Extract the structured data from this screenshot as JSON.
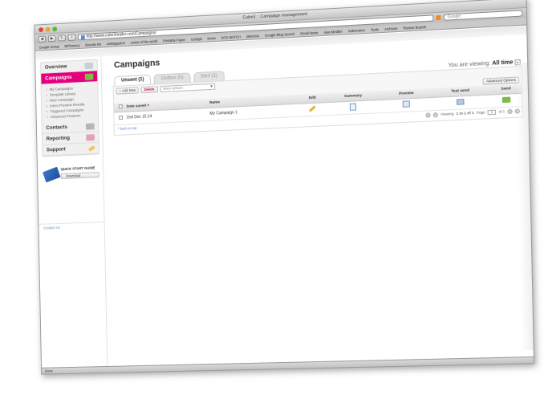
{
  "window": {
    "title": "Cube3 :: Campaign management",
    "url": "http://www.cube3mailer.com/Campaigns/",
    "search_placeholder": "Google",
    "status": "Done"
  },
  "bookmarks": [
    "Google Group",
    "DiPlomacy",
    "Bonobo list",
    "netMagazine",
    "center of the world",
    "Printable Paper",
    "GoDigit",
    "News",
    "SOS WATCH",
    "delicious",
    "Google Blog Search",
    "Email News",
    "Ajax Mediter",
    "Subversion",
    "Tools",
    "Archives",
    "Review Boards"
  ],
  "sidebar": {
    "overview": "Overview",
    "campaigns": "Campaigns",
    "sub_items": [
      "My Campaigns",
      "Template Library",
      "New Campaign",
      "Inbox Preview Results",
      "Triggered Campaigns",
      "Advanced Features"
    ],
    "contacts": "Contacts",
    "reporting": "Reporting",
    "support": "Support",
    "guide_title": "QUICK START GUIDE",
    "guide_button": "Download",
    "contact_link": "Contact Us"
  },
  "main": {
    "title": "Campaigns",
    "tabs": [
      {
        "label": "Unsent (1)",
        "active": true
      },
      {
        "label": "Outbox (0)",
        "active": false
      },
      {
        "label": "Sent (1)",
        "active": false
      }
    ],
    "viewing_label": "You are viewing:",
    "viewing_value": "All time",
    "add_new": "+ Add New",
    "delete": "Delete",
    "more_actions": "More actions",
    "advanced_options": "Advanced Options",
    "columns": [
      "Date saved",
      "Name",
      "Edit",
      "Summary",
      "Preview",
      "Test send",
      "Send"
    ],
    "rows": [
      {
        "date": "2nd Dec 15:14",
        "name": "My Campaign 1"
      }
    ],
    "back_to_top": "^ back to top",
    "pager_viewing": "Viewing",
    "pager_range": "1 to 1 of 1",
    "pager_page_label": "Page",
    "pager_page_value": "1",
    "pager_of": "of 1"
  },
  "colors": {
    "accent": "#e6007e",
    "send_green": "#7cbd49",
    "link_blue": "#5b86c4"
  }
}
